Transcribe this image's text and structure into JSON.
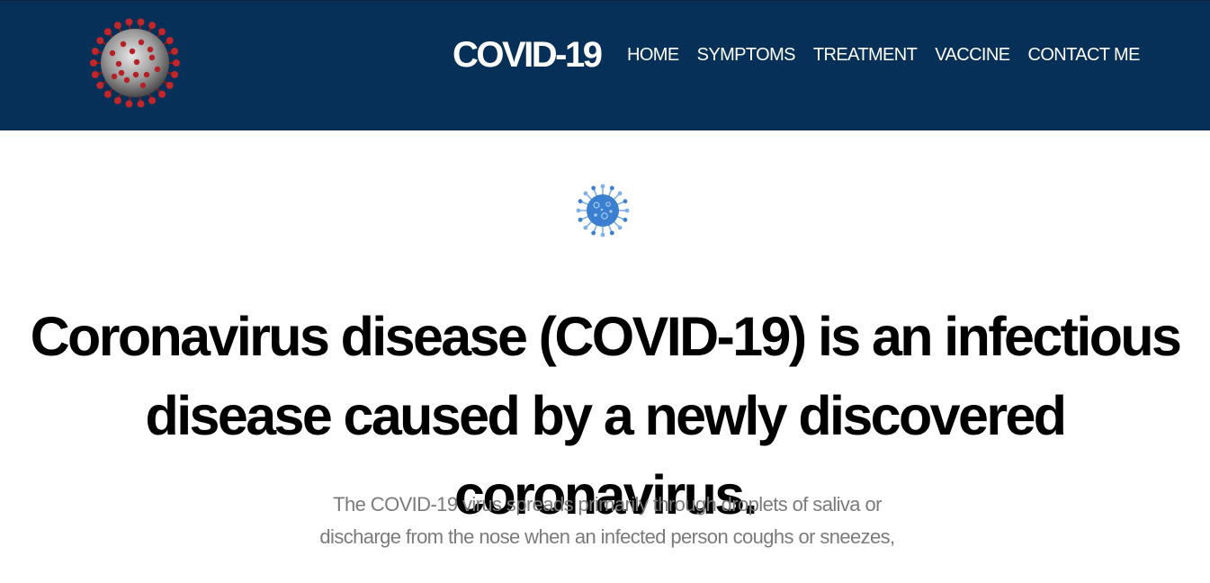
{
  "header": {
    "brand": "COVID-19",
    "logo_icon": "coronavirus-icon",
    "background_color": "#063057",
    "nav": [
      {
        "label": "HOME"
      },
      {
        "label": "SYMPTOMS"
      },
      {
        "label": "TREATMENT"
      },
      {
        "label": "VACCINE"
      },
      {
        "label": "CONTACT ME"
      }
    ]
  },
  "main": {
    "hero_icon": "virus-icon",
    "headline": "Coronavirus disease (COVID-19) is an infectious disease caused by a newly discovered coronavirus.",
    "body": "The COVID-19 virus spreads primarily through droplets of saliva or discharge from the nose when an infected person coughs or sneezes,"
  }
}
